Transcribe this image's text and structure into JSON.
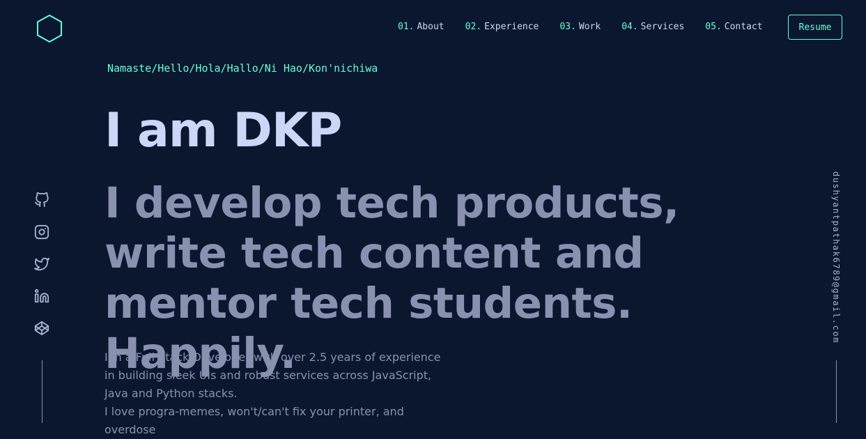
{
  "header": {
    "logo_icon": "hexagon-logo-icon",
    "nav": [
      {
        "num": "01.",
        "label": "About"
      },
      {
        "num": "02.",
        "label": "Experience"
      },
      {
        "num": "03.",
        "label": "Work"
      },
      {
        "num": "04.",
        "label": "Services"
      },
      {
        "num": "05.",
        "label": "Contact"
      }
    ],
    "resume_label": "Resume"
  },
  "hero": {
    "greeting": "Namaste/Hello/Hola/Hallo/Ni Hao/Kon'nichiwa",
    "name": "I am DKP",
    "tagline": "I develop tech products, write tech content and mentor tech students. Happily.",
    "description_line1": "I'm a Full Stack Developer with over 2.5 years of experience in building sleek UIs and robust services across JavaScript, Java and Python stacks.",
    "description_line2": "I love progra-memes, won't/can't fix your printer, and overdose"
  },
  "social": [
    "github-icon",
    "instagram-icon",
    "twitter-icon",
    "linkedin-icon",
    "codepen-icon"
  ],
  "email": "dushyantpathak6789@gmail.com",
  "colors": {
    "background": "#0b172e",
    "accent": "#64ffda",
    "heading": "#ccd6f6",
    "text": "#8892b0"
  }
}
